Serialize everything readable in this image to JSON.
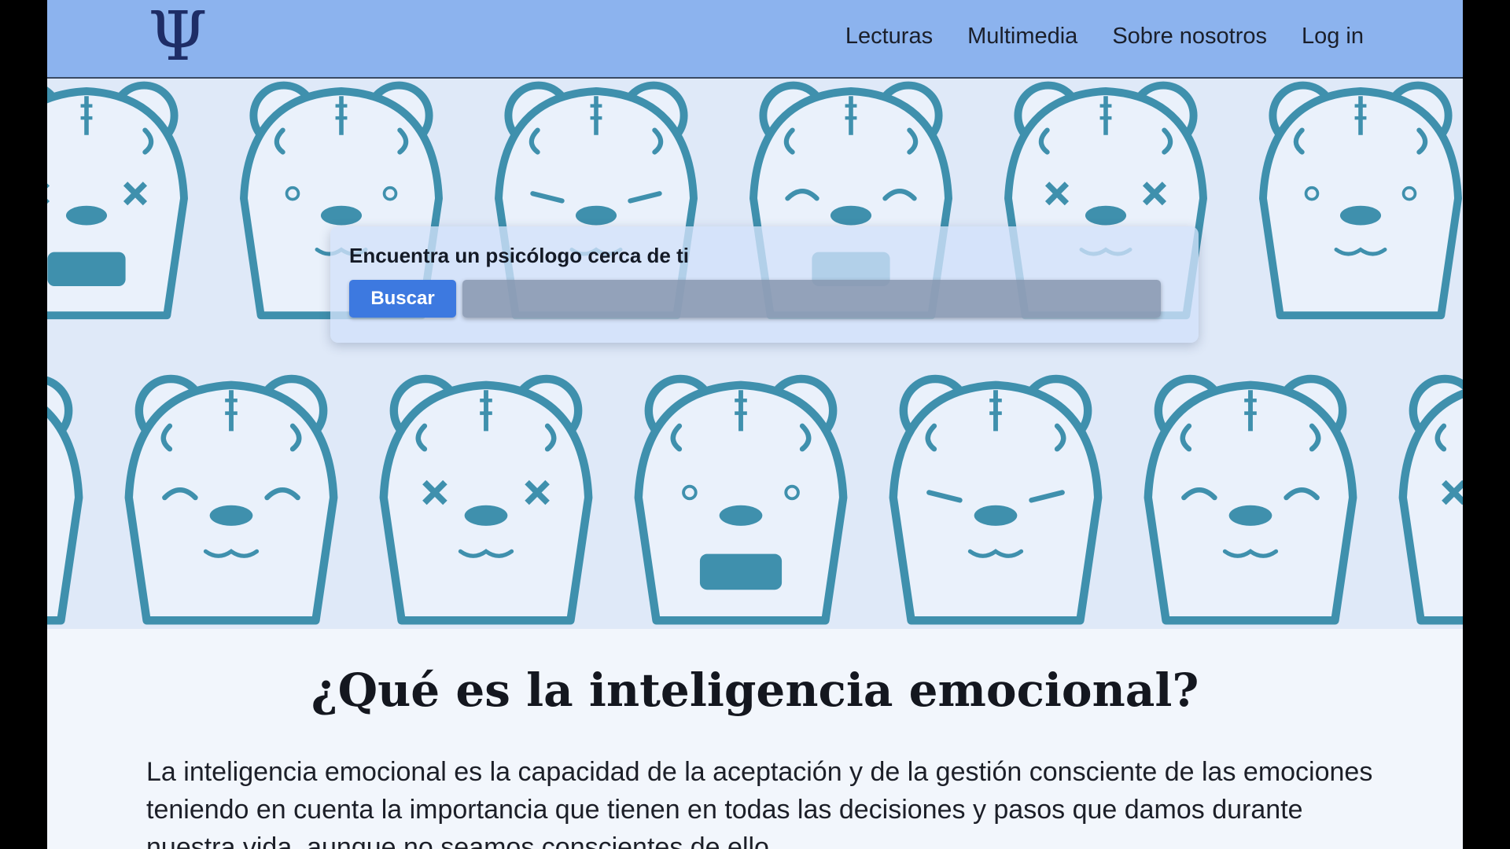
{
  "nav": {
    "logo_symbol": "Ψ",
    "links": [
      "Lecturas",
      "Multimedia",
      "Sobre nosotros",
      "Log in"
    ]
  },
  "hero": {
    "image": "repeating-bear-faces-illustration",
    "search": {
      "title": "Encuentra un psicólogo cerca de ti",
      "button_label": "Buscar",
      "input_value": "",
      "input_placeholder": ""
    }
  },
  "article": {
    "title": "¿Qué es la inteligencia emocional?",
    "body": "La inteligencia emocional es la capacidad de la aceptación y de la gestión consciente de las emociones teniendo en cuenta la importancia que tienen en todas las decisiones y pasos que damos durante nuestra vida, aunque no seamos conscientes de ello."
  },
  "colors": {
    "nav_bg": "#8cb3ee",
    "hero_bg": "#dfe9f8",
    "bear_blue": "#3f90ad",
    "bear_red": "#8f2f3e",
    "button_blue": "#3d79e0",
    "logo": "#1e2d66"
  }
}
